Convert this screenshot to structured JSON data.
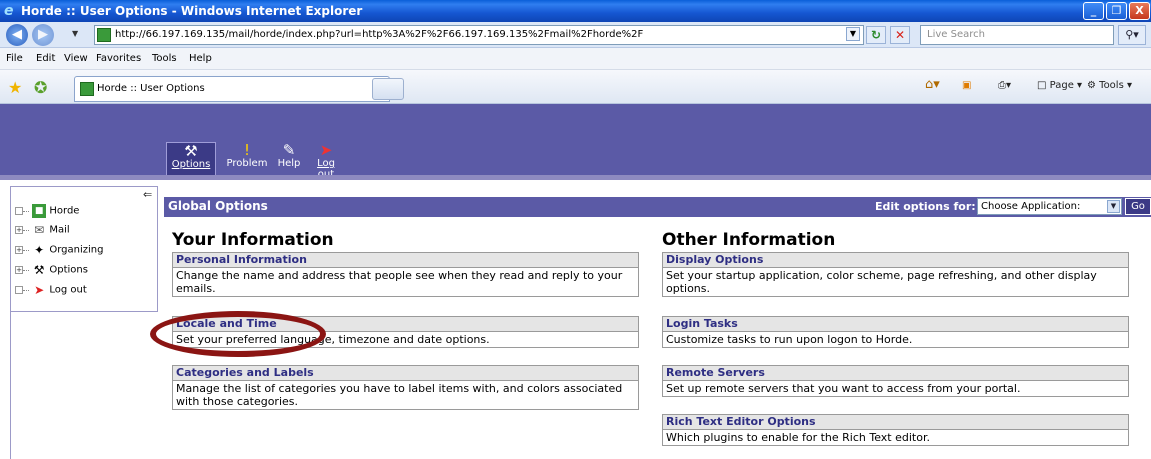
{
  "window": {
    "title": "Horde :: User Options - Windows Internet Explorer",
    "buttons": {
      "minimize": "_",
      "maximize": "❐",
      "close": "X"
    }
  },
  "address_bar": {
    "url": "http://66.197.169.135/mail/horde/index.php?url=http%3A%2F%2F66.197.169.135%2Fmail%2Fhorde%2F",
    "search_placeholder": "Live Search"
  },
  "menu": [
    "File",
    "Edit",
    "View",
    "Favorites",
    "Tools",
    "Help"
  ],
  "tab": {
    "label": "Horde :: User Options"
  },
  "command_bar": {
    "page": "Page",
    "tools": "Tools"
  },
  "horde_toolbar": [
    {
      "label": "Options",
      "icon": "tools-icon",
      "active": true
    },
    {
      "label": "Problem",
      "icon": "problem-icon"
    },
    {
      "label": "Help",
      "icon": "help-icon"
    },
    {
      "label": "Log out",
      "icon": "logout-icon"
    }
  ],
  "sidebar": [
    {
      "label": "Horde",
      "icon": "horde-icon",
      "expandable": false
    },
    {
      "label": "Mail",
      "icon": "mail-icon",
      "expandable": true
    },
    {
      "label": "Organizing",
      "icon": "organizing-icon",
      "expandable": true
    },
    {
      "label": "Options",
      "icon": "options-icon",
      "expandable": true
    },
    {
      "label": "Log out",
      "icon": "logout-icon",
      "expandable": false
    }
  ],
  "global": {
    "title": "Global Options",
    "edit_label": "Edit options for:",
    "app_select": "Choose Application:",
    "go": "Go"
  },
  "your_info": {
    "title": "Your Information",
    "items": [
      {
        "head": "Personal Information",
        "desc": "Change the name and address that people see when they read and reply to your emails."
      },
      {
        "head": "Locale and Time",
        "desc": "Set your preferred language, timezone and date options."
      },
      {
        "head": "Categories and Labels",
        "desc": "Manage the list of categories you have to label items with, and colors associated with those categories."
      }
    ]
  },
  "other_info": {
    "title": "Other Information",
    "items": [
      {
        "head": "Display Options",
        "desc": "Set your startup application, color scheme, page refreshing, and other display options."
      },
      {
        "head": "Login Tasks",
        "desc": "Customize tasks to run upon logon to Horde."
      },
      {
        "head": "Remote Servers",
        "desc": "Set up remote servers that you want to access from your portal."
      },
      {
        "head": "Rich Text Editor Options",
        "desc": "Which plugins to enable for the Rich Text editor."
      }
    ]
  },
  "colors": {
    "horde_purple": "#5b5aa6",
    "link_blue": "#2e2e83",
    "annotation": "#8b1513"
  }
}
